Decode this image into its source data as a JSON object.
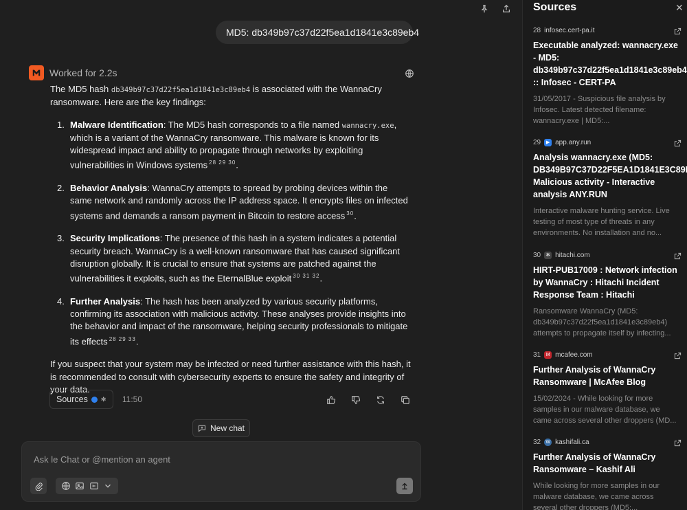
{
  "user_message": "MD5: db349b97c37d22f5ea1d1841e3c89eb4",
  "agent": {
    "status": "Worked for 2.2s"
  },
  "answer": {
    "intro_pre": "The MD5 hash ",
    "intro_hash": "db349b97c37d22f5ea1d1841e3c89eb4",
    "intro_post": " is associated with the WannaCry ransomware. Here are the key findings:",
    "items": [
      {
        "num": "1.",
        "title": "Malware Identification",
        "text_a": ": The MD5 hash corresponds to a file named ",
        "code": "wannacry.exe",
        "text_b": ", which is a variant of the WannaCry ransomware. This malware is known for its widespread impact and ability to propagate through networks by exploiting vulnerabilities in Windows systems",
        "cites": "28 29 30",
        "end": "."
      },
      {
        "num": "2.",
        "title": "Behavior Analysis",
        "text_a": ": WannaCry attempts to spread by probing devices within the same network and randomly across the IP address space. It encrypts files on infected systems and demands a ransom payment in Bitcoin to restore access",
        "code": "",
        "text_b": "",
        "cites": "30",
        "end": "."
      },
      {
        "num": "3.",
        "title": "Security Implications",
        "text_a": ": The presence of this hash in a system indicates a potential security breach. WannaCry is a well-known ransomware that has caused significant disruption globally. It is crucial to ensure that systems are patched against the vulnerabilities it exploits, such as the EternalBlue exploit",
        "code": "",
        "text_b": "",
        "cites": "30 31 32",
        "end": "."
      },
      {
        "num": "4.",
        "title": "Further Analysis",
        "text_a": ": The hash has been analyzed by various security platforms, confirming its association with malicious activity. These analyses provide insights into the behavior and impact of the ransomware, helping security professionals to mitigate its effects",
        "code": "",
        "text_b": "",
        "cites": "28 29 33",
        "end": "."
      }
    ],
    "closing": "If you suspect that your system may be infected or need further assistance with this hash, it is recommended to consult with cybersecurity experts to ensure the safety and integrity of your data."
  },
  "meta": {
    "sources_label": "Sources",
    "time": "11:50"
  },
  "new_chat_label": "New chat",
  "composer": {
    "placeholder": "Ask le Chat or @mention an agent"
  },
  "sources_panel": {
    "title": "Sources",
    "items": [
      {
        "num": "28",
        "domain": "infosec.cert-pa.it",
        "favicon_color": "#555555",
        "title": "Executable analyzed: wannacry.exe\n- MD5:\ndb349b97c37d22f5ea1d1841e3c89eb4\n:: Infosec - CERT-PA",
        "snippet": "31/05/2017 - Suspicious file analysis by\nInfosec. Latest detected filename:\nwannacry.exe | MD5:..."
      },
      {
        "num": "29",
        "domain": "app.any.run",
        "favicon_color": "#2f80ed",
        "title": "Analysis wannacry.exe (MD5:\nDB349B97C37D22F5EA1D1841E3C89EB4)\nMalicious activity - Interactive\nanalysis ANY.RUN",
        "snippet": "Interactive malware hunting service. Live\ntesting of most type of threats in any\nenvironments. No installation and no..."
      },
      {
        "num": "30",
        "domain": "hitachi.com",
        "favicon_color": "#444444",
        "title": "HIRT-PUB17009 : Network infection\nby WannaCry : Hitachi Incident\nResponse Team : Hitachi",
        "snippet": "Ransomware WannaCry (MD5:\ndb349b97c37d22f5ea1d1841e3c89eb4)\nattempts to propagate itself by infecting..."
      },
      {
        "num": "31",
        "domain": "mcafee.com",
        "favicon_color": "#c0262d",
        "title": "Further Analysis of WannaCry\nRansomware | McAfee Blog",
        "snippet": "15/02/2024 - While looking for more\nsamples in our malware database, we\ncame across several other droppers (MD..."
      },
      {
        "num": "32",
        "domain": "kashifali.ca",
        "favicon_color": "#3a6ea5",
        "title": "Further Analysis of WannaCry\nRansomware – Kashif Ali",
        "snippet": "While looking for more samples in our\nmalware database, we came across\nseveral other droppers (MD5:..."
      }
    ]
  }
}
